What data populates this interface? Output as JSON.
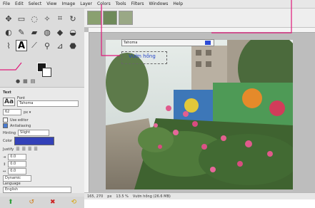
{
  "menubar": {
    "items": [
      "File",
      "Edit",
      "Select",
      "View",
      "Image",
      "Layer",
      "Colors",
      "Tools",
      "Filters",
      "Windows",
      "Help"
    ]
  },
  "toolbox": {
    "tools": [
      {
        "icon": "move-icon",
        "glyph": "✥"
      },
      {
        "icon": "align-icon",
        "glyph": "▭"
      },
      {
        "icon": "free-select-icon",
        "glyph": "◌"
      },
      {
        "icon": "fuzzy-select-icon",
        "glyph": "✧"
      },
      {
        "icon": "crop-icon",
        "glyph": "⌗"
      },
      {
        "icon": "rotate-icon",
        "glyph": "↻"
      },
      {
        "icon": "warp-icon",
        "glyph": "◐"
      },
      {
        "icon": "paintbrush-icon",
        "glyph": "✎"
      },
      {
        "icon": "eraser-icon",
        "glyph": "▰"
      },
      {
        "icon": "clone-icon",
        "glyph": "◍"
      },
      {
        "icon": "blur-icon",
        "glyph": "◆"
      },
      {
        "icon": "dodge-icon",
        "glyph": "◒"
      },
      {
        "icon": "path-icon",
        "glyph": "⌇"
      },
      {
        "icon": "text-icon",
        "glyph": "A",
        "active": true
      },
      {
        "icon": "color-picker-icon",
        "glyph": "⟋"
      },
      {
        "icon": "zoom-icon",
        "glyph": "⚲"
      },
      {
        "icon": "measure-icon",
        "glyph": "⊿"
      },
      {
        "icon": "bucket-fill-icon",
        "glyph": "⬣"
      }
    ]
  },
  "tool_options": {
    "section": "Text",
    "font_label": "Font",
    "font_value": "Tahoma",
    "size_value": "62",
    "use_editor": "Use editor",
    "antialiasing": "Antialiasing",
    "hinting_label": "Hinting",
    "hinting_value": "Slight",
    "color_label": "Color",
    "justify_label": "Justify",
    "indent_value": "0.0",
    "line_spacing_value": "0.0",
    "letter_spacing_value": "0.0",
    "box_value": "Dynamic",
    "language_label": "Language",
    "language_value": "English"
  },
  "canvas": {
    "text_toolbar_font": "Tahoma",
    "text_content": "Vườn hồng",
    "text_color": "#2646c8"
  },
  "statusbar": {
    "coords": "165, 270",
    "unit": "px",
    "zoom": "13.5 %",
    "layer": "Vườn hồng (26.6 MB)"
  }
}
